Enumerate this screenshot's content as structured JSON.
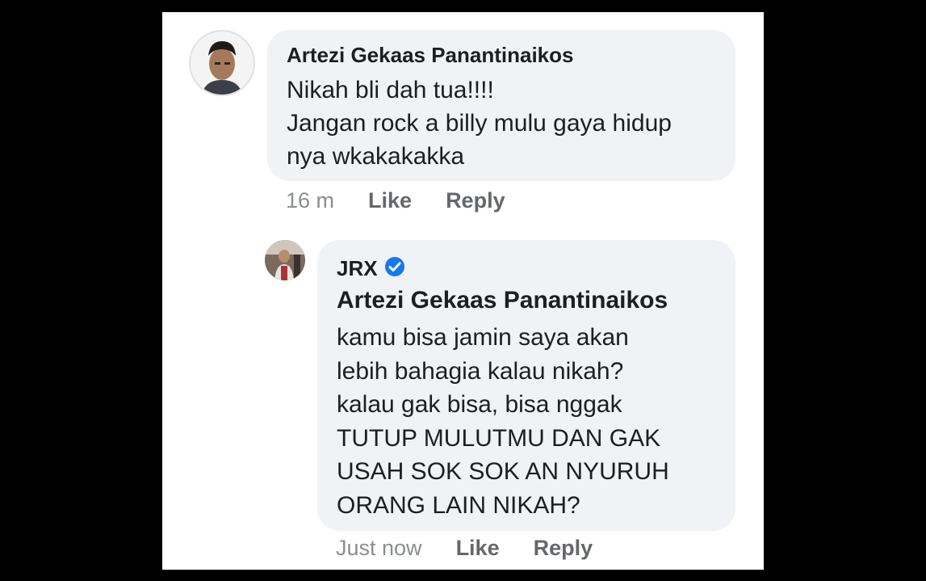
{
  "colors": {
    "background": "#000000",
    "panel": "#ffffff",
    "bubble": "#f0f2f5",
    "text": "#1c1e21",
    "meta": "#8a8d91",
    "verified": "#1877f2"
  },
  "comment": {
    "author": "Artezi Gekaas Panantinaikos",
    "lines": [
      "Nikah bli dah tua!!!!",
      "Jangan rock a billy mulu gaya hidup",
      "nya wkakakakka"
    ],
    "time": "16 m",
    "like_label": "Like",
    "reply_label": "Reply"
  },
  "reply": {
    "author": "JRX",
    "verified_icon": "verified-badge-icon",
    "mention": "Artezi Gekaas Panantinaikos",
    "lines": [
      "kamu bisa jamin saya akan",
      "lebih bahagia kalau nikah?",
      "kalau gak bisa, bisa nggak",
      "TUTUP MULUTMU DAN GAK",
      "USAH SOK SOK AN NYURUH",
      "ORANG LAIN NIKAH?"
    ],
    "time": "Just now",
    "like_label": "Like",
    "reply_label": "Reply"
  }
}
